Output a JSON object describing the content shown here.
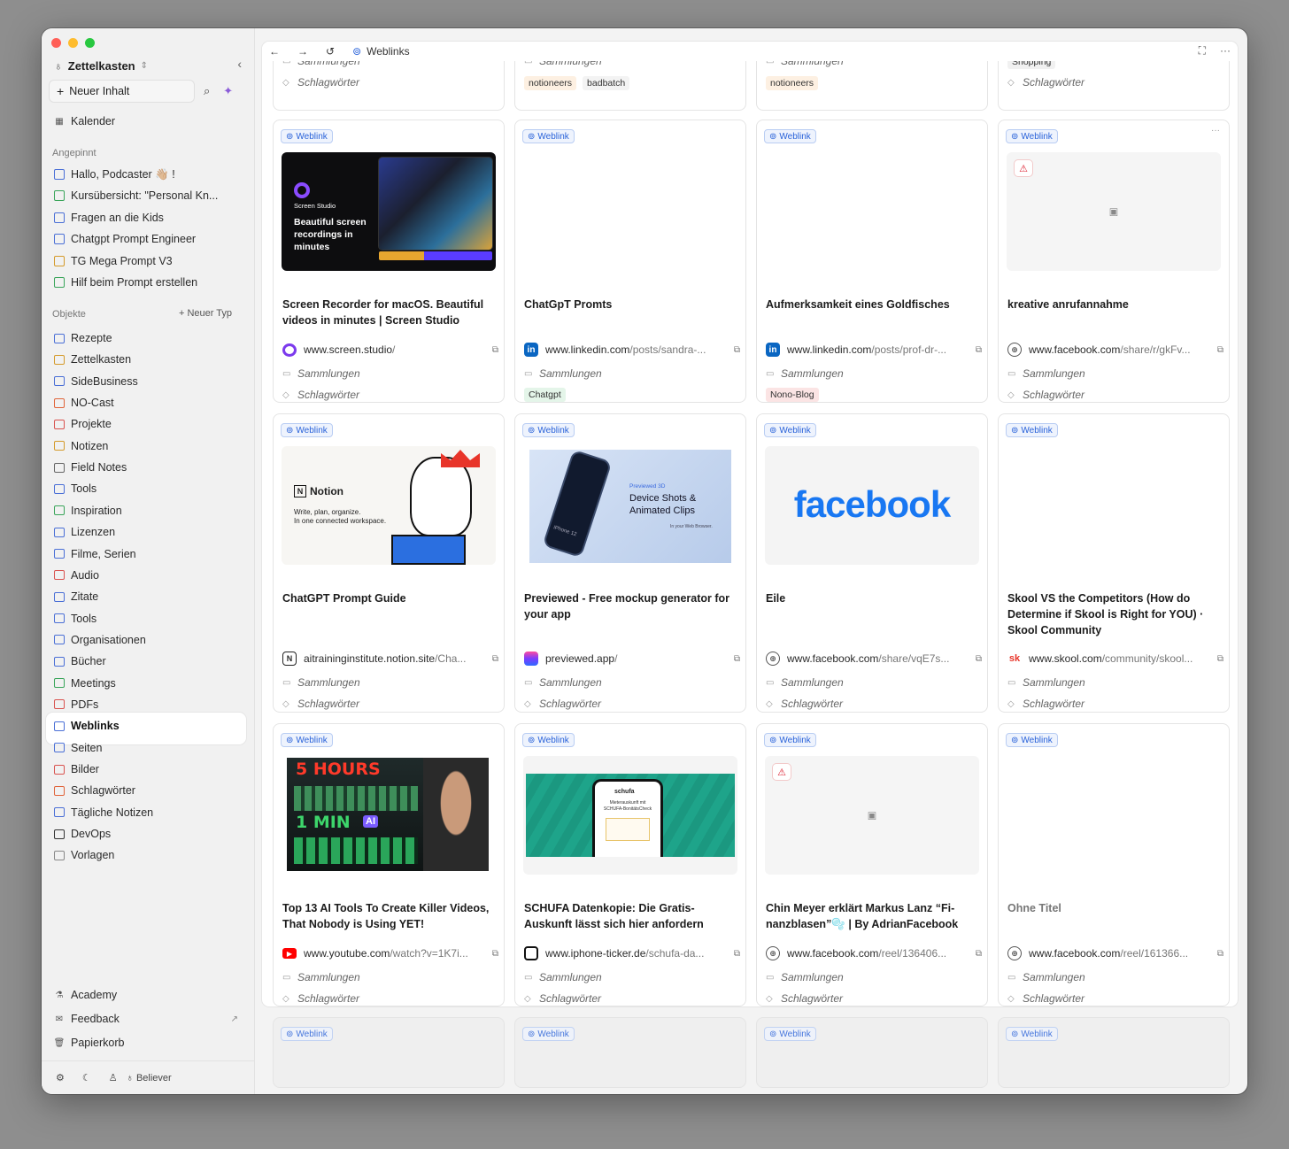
{
  "sidebar": {
    "workspace": "Zettelkasten",
    "new_content": "Neuer Inhalt",
    "calendar": "Kalender",
    "pinned_heading": "Angepinnt",
    "pinned": [
      {
        "label": "Hallo, Podcaster 👋🏼 !",
        "color": "#4a6fd6"
      },
      {
        "label": "Kursübersicht: \"Personal Kn...",
        "color": "#3aa55a"
      },
      {
        "label": "Fragen an die Kids",
        "color": "#4a6fd6"
      },
      {
        "label": "Chatgpt Prompt Engineer",
        "color": "#4a6fd6"
      },
      {
        "label": "TG Mega Prompt V3",
        "color": "#d49a2a"
      },
      {
        "label": "Hilf beim Prompt erstellen",
        "color": "#3aa55a"
      }
    ],
    "objects_heading": "Objekte",
    "new_type": "+ Neuer Typ",
    "objects": [
      {
        "label": "Rezepte",
        "color": "#4a6fd6"
      },
      {
        "label": "Zettelkasten",
        "color": "#d49a2a"
      },
      {
        "label": "SideBusiness",
        "color": "#4a6fd6"
      },
      {
        "label": "NO-Cast",
        "color": "#e0643a"
      },
      {
        "label": "Projekte",
        "color": "#d9534f"
      },
      {
        "label": "Notizen",
        "color": "#d49a2a"
      },
      {
        "label": "Field Notes",
        "color": "#666666"
      },
      {
        "label": "Tools",
        "color": "#4a6fd6"
      },
      {
        "label": "Inspiration",
        "color": "#3aa55a"
      },
      {
        "label": "Lizenzen",
        "color": "#4a6fd6"
      },
      {
        "label": "Filme, Serien",
        "color": "#4a6fd6"
      },
      {
        "label": "Audio",
        "color": "#d9534f"
      },
      {
        "label": "Zitate",
        "color": "#4a6fd6"
      },
      {
        "label": "Tools",
        "color": "#4a6fd6"
      },
      {
        "label": "Organisationen",
        "color": "#4a6fd6"
      },
      {
        "label": "Bücher",
        "color": "#4a6fd6"
      },
      {
        "label": "Meetings",
        "color": "#3aa55a"
      },
      {
        "label": "PDFs",
        "color": "#d9534f"
      },
      {
        "label": "Weblinks",
        "color": "#4a6fd6"
      },
      {
        "label": "Seiten",
        "color": "#4a6fd6"
      },
      {
        "label": "Bilder",
        "color": "#d9534f"
      },
      {
        "label": "Schlagwörter",
        "color": "#e0643a"
      },
      {
        "label": "Tägliche Notizen",
        "color": "#4a6fd6"
      },
      {
        "label": "DevOps",
        "color": "#333333"
      },
      {
        "label": "Vorlagen",
        "color": "#888888"
      }
    ],
    "academy": "Academy",
    "feedback": "Feedback",
    "trash": "Papierkorb",
    "profile": "Believer"
  },
  "topbar": {
    "title": "Weblinks"
  },
  "labels": {
    "badge": "Weblink",
    "collections": "Sammlungen",
    "tags": "Schlagwörter"
  },
  "top_partial": [
    {
      "tags": []
    },
    {
      "tags": [
        {
          "t": "notioneers",
          "bg": "#fdf0e2"
        },
        {
          "t": "badbatch",
          "bg": "#f3f3f3"
        }
      ]
    },
    {
      "tags": [
        {
          "t": "notioneers",
          "bg": "#fdf0e2"
        }
      ]
    },
    {
      "collection_tag": "Shopping"
    }
  ],
  "cards": [
    {
      "title": "Screen Recorder for macOS. Beautiful videos in minutes | Screen Studio",
      "domain": "www.screen.studio",
      "path": "/",
      "tags": []
    },
    {
      "title": "ChatGpT Promts",
      "domain": "www.linkedin.com",
      "path": "/posts/sandra-...",
      "tags": [
        {
          "t": "Chatgpt",
          "bg": "#e4f5e9"
        }
      ]
    },
    {
      "title": "Aufmerksamkeit eines Goldfisches",
      "domain": "www.linkedin.com",
      "path": "/posts/prof-dr-...",
      "tags": [
        {
          "t": "Nono-Blog",
          "bg": "#fbe4e4"
        }
      ]
    },
    {
      "title": "kreative anrufannahme",
      "domain": "www.facebook.com",
      "path": "/share/r/gkFv...",
      "tags": []
    },
    {
      "title": "ChatGPT Prompt Guide",
      "domain": "aitraininginstitute.notion.site",
      "path": "/Cha...",
      "tags": []
    },
    {
      "title": "Previewed - Free mockup generator for your app",
      "domain": "previewed.app",
      "path": "/",
      "tags": []
    },
    {
      "title": "Eile",
      "domain": "www.facebook.com",
      "path": "/share/vqE7s...",
      "tags": []
    },
    {
      "title": "Skool VS the Competitors (How do Determine if Skool is Right for YOU) · Skool Community",
      "domain": "www.skool.com",
      "path": "/community/skool...",
      "tags": []
    },
    {
      "title": "Top 13 AI Tools To Create Killer Videos, That Nobody is Using YET!",
      "domain": "www.youtube.com",
      "path": "/watch?v=1K7i...",
      "tags": []
    },
    {
      "title": "SCHUFA Datenkopie: Die Gratis-Auskunft lässt sich hier anfordern",
      "domain": "www.iphone-ticker.de",
      "path": "/schufa-da...",
      "tags": []
    },
    {
      "title": "Chin Meyer erklärt Markus Lanz “Fi-nanzblasen”🫧 | By AdrianFacebook",
      "domain": "www.facebook.com",
      "path": "/reel/136406...",
      "tags": []
    },
    {
      "title": "Ohne Titel",
      "domain": "www.facebook.com",
      "path": "/reel/161366...",
      "tags": []
    }
  ],
  "thumbs": {
    "screen_studio": {
      "brand": "Screen Studio",
      "headline": "Beautiful screen recordings in minutes"
    },
    "notion": {
      "brand": "Notion",
      "line1": "Write, plan, organize.",
      "line2": "In one connected workspace."
    },
    "previewed": {
      "kicker": "Previewed 3D",
      "headline": "Device Shots & Animated Clips",
      "sub": "In your Web Browser.",
      "phone": "iPhone 12"
    },
    "facebook": {
      "logo": "facebook"
    },
    "youtube": {
      "top": "5 HOURS",
      "bottom": "1 MIN",
      "ai": "AI"
    },
    "schufa": {
      "brand": "schufa",
      "text": "Mieterauskunft mit SCHUFA-BonitätsCheck"
    }
  },
  "colors": {
    "accent": "#2962d9",
    "badge_bg": "#eef3fd",
    "badge_border": "#b9cdf3"
  }
}
